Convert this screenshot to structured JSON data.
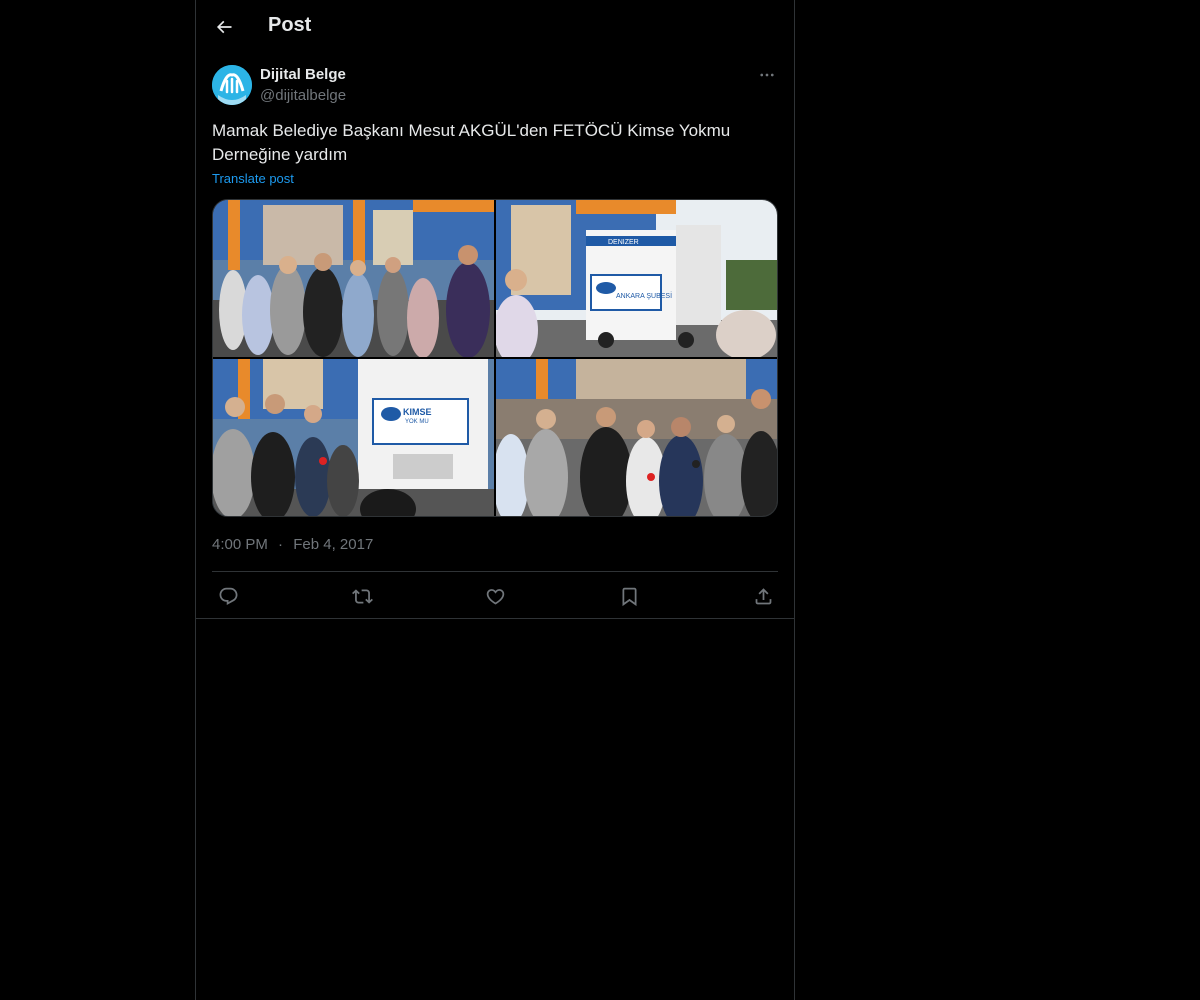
{
  "header": {
    "title": "Post"
  },
  "post": {
    "author_name": "Dijital Belge",
    "author_handle": "@dijitalbelge",
    "text": "Mamak Belediye Başkanı Mesut AKGÜL'den FETÖCÜ Kimse Yokmu Derneğine yardım",
    "translate_label": "Translate post",
    "time": "4:00 PM",
    "separator": "·",
    "date": "Feb 4, 2017",
    "media_count": 4,
    "media_text": {
      "truck_top": "DENIZER",
      "banner_line1": "KIMSE",
      "banner_line2": "YOK MU",
      "banner_line3": "ANKARA ŞUBESİ"
    }
  },
  "icons": {
    "back": "arrow-left-icon",
    "more": "more-horizontal-icon",
    "reply": "reply-icon",
    "repost": "repost-icon",
    "like": "heart-icon",
    "bookmark": "bookmark-icon",
    "share": "share-icon"
  },
  "colors": {
    "background": "#000000",
    "border": "#2f3336",
    "text": "#e7e9ea",
    "muted": "#71767b",
    "accent": "#1d9bf0"
  }
}
